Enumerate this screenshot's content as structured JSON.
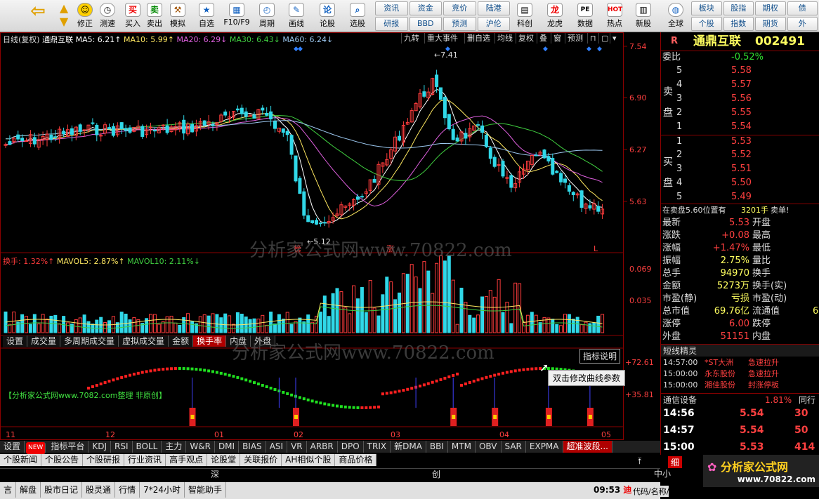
{
  "toolbar": {
    "back": "",
    "fix": "修正",
    "predict": "测速",
    "buy": "买入",
    "sell": "卖出",
    "sim": "模拟",
    "self": "自选",
    "f10": "F10/F9",
    "period": "周期",
    "line": "画线",
    "stock": "论股",
    "select": "选股",
    "grid": [
      "资讯",
      "资金",
      "竞价",
      "陆港",
      "研报",
      "BBD",
      "预测",
      "沪伦"
    ],
    "science": "科创",
    "dragon": "龙虎",
    "data": "数据",
    "hot": "热点",
    "news": "新股",
    "global": "全球",
    "grid2": [
      "板块",
      "股指",
      "期权",
      "债",
      "个股",
      "指数",
      "期货",
      "外"
    ]
  },
  "main": {
    "title": "日线(复权)",
    "name": "通鼎互联",
    "ma5": "MA5: 6.21↑",
    "ma10": "MA10: 5.99↑",
    "ma20": "MA20: 6.29↓",
    "ma30": "MA30: 6.43↓",
    "ma60": "MA60: 6.24↓",
    "buttons": [
      "九转",
      "重大事件",
      "删自选",
      "均线",
      "复权",
      "叠",
      "窗",
      "预测"
    ],
    "prices": [
      "7.54",
      "6.90",
      "6.27",
      "5.63"
    ],
    "high_label": "7.41",
    "low_label": "5.12",
    "watermark": "分析家公式网www.70822.com",
    "mark_bang": "榜",
    "mark_zhang": "涨",
    "mark_L": "L"
  },
  "vol": {
    "label": "换手: 1.32%↑",
    "mavol5": "MAVOL5: 2.87%↑",
    "mavol10": "MAVOL10: 2.11%↓",
    "ticks": [
      "0.069",
      "0.035"
    ]
  },
  "tabs1": [
    "设置",
    "成交量",
    "多周期成交量",
    "虚拟成交量",
    "金额",
    "换手率",
    "内盘",
    "外盘"
  ],
  "ind": {
    "explain": "指标说明",
    "tooltip": "双击修改曲线参数",
    "caption": "【分析家公式网www.7082.com整理 非原创】",
    "ticks": [
      "+72.61",
      "+35.81"
    ],
    "watermark": "分析家公式网www.70822.com"
  },
  "dates": [
    "11",
    "12",
    "01",
    "02",
    "03",
    "04",
    "05"
  ],
  "tabs2": [
    "设置",
    "NEW",
    "指标平台",
    "KDJ",
    "RSI",
    "BOLL",
    "主力",
    "W&R",
    "DMI",
    "BIAS",
    "ASI",
    "VR",
    "ARBR",
    "DPO",
    "TRIX",
    "新DMA",
    "BBI",
    "MTM",
    "OBV",
    "SAR",
    "EXPMA",
    "超准波段..."
  ],
  "tabs3": [
    "个股新闻",
    "个股公告",
    "个股研报",
    "行业资讯",
    "高手观点",
    "论股堂",
    "关联报价",
    "AH相似个股",
    "商品价格"
  ],
  "status": [
    "深",
    "创"
  ],
  "bottombar": [
    "言",
    "解盘",
    "股市日记",
    "股灵通",
    "行情",
    "7*24小时",
    "智能助手"
  ],
  "clock": "09:53",
  "right": {
    "r": "R",
    "name": "通鼎互联",
    "code": "002491",
    "weibi_label": "委比",
    "weibi": "-0.52%",
    "sell_label": "卖\n盘",
    "buy_label": "买\n盘",
    "asks": [
      [
        "5",
        "5.58"
      ],
      [
        "4",
        "5.57"
      ],
      [
        "3",
        "5.56"
      ],
      [
        "2",
        "5.55"
      ],
      [
        "1",
        "5.54"
      ]
    ],
    "bids": [
      [
        "1",
        "5.53"
      ],
      [
        "2",
        "5.52"
      ],
      [
        "3",
        "5.51"
      ],
      [
        "4",
        "5.50"
      ],
      [
        "5",
        "5.49"
      ]
    ],
    "order_note": "在卖盘5.60位置有",
    "order_qty": "3201手",
    "order_tag": "卖单!",
    "stats": [
      [
        "最新",
        "5.53",
        "开盘",
        ""
      ],
      [
        "涨跌",
        "+0.08",
        "最高",
        ""
      ],
      [
        "涨幅",
        "+1.47%",
        "最低",
        ""
      ],
      [
        "振幅",
        "2.75%",
        "量比",
        ""
      ],
      [
        "总手",
        "94970",
        "换手",
        ""
      ],
      [
        "金额",
        "5273万",
        "换手(实)",
        ""
      ],
      [
        "市盈(静)",
        "亏损",
        "市盈(动)",
        ""
      ],
      [
        "总市值",
        "69.76亿",
        "流通值",
        "6"
      ],
      [
        "涨停",
        "6.00",
        "跌停",
        ""
      ],
      [
        "外盘",
        "51151",
        "内盘",
        ""
      ]
    ],
    "elite": "短线精灵",
    "news": [
      [
        "14:57:00",
        "*ST大洲",
        "急速拉升"
      ],
      [
        "15:00:00",
        "永东股份",
        "急速拉升"
      ],
      [
        "15:00:00",
        "湘佳股份",
        "封涨停板"
      ]
    ],
    "device": "通信设备",
    "device_pct": "1.81%",
    "tong": "同行",
    "trades": [
      [
        "14:56",
        "5.54",
        "30"
      ],
      [
        "14:57",
        "5.54",
        "50"
      ],
      [
        "15:00",
        "5.53",
        "414"
      ]
    ],
    "xi": "细",
    "zhong": "中小",
    "logo": "分析家公式网",
    "logo_url": "www.70822.com",
    "code_label": "代码/名称/"
  },
  "colors": {
    "up": "#ff3c3c",
    "down": "#30d8e8",
    "ma5": "#ffffff",
    "ma10": "#ffe860",
    "ma20": "#e060e0",
    "ma30": "#40d040",
    "ma60": "#9cc8f0"
  }
}
